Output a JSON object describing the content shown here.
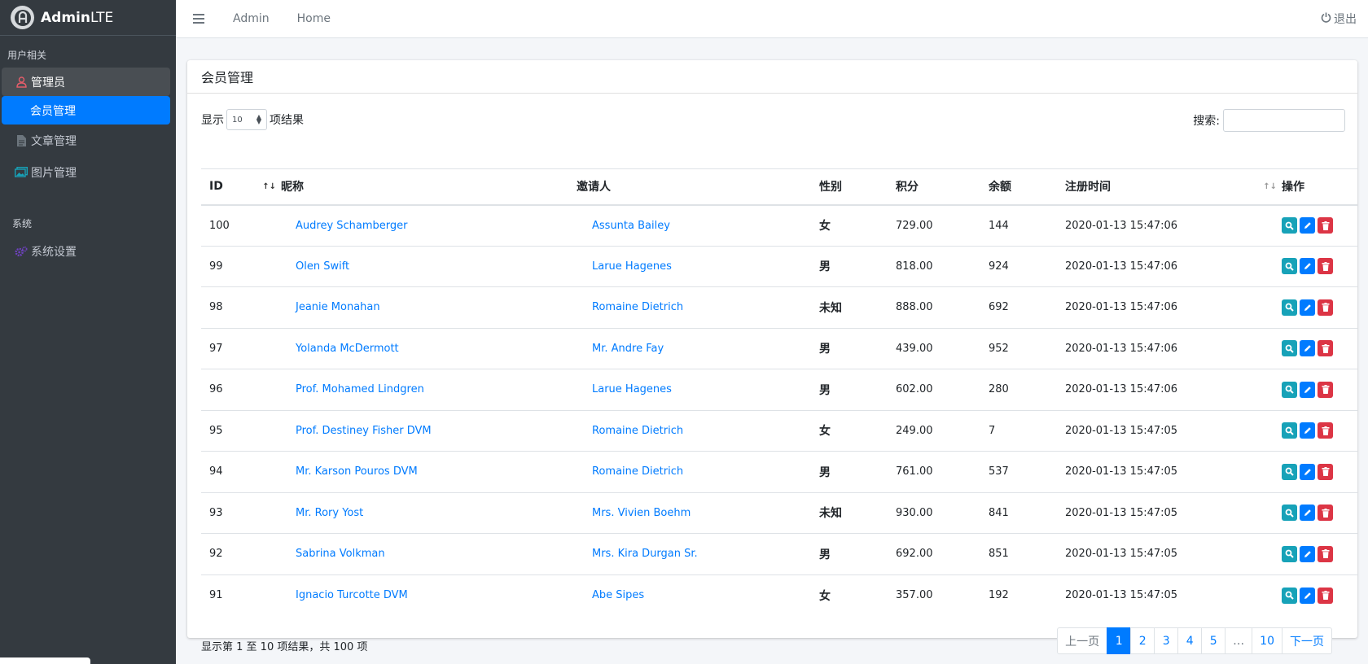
{
  "brand": {
    "name_bold": "Admin",
    "name_light": "LTE"
  },
  "sidebar": {
    "section1": "用户相关",
    "items": [
      {
        "label": "管理员",
        "icon": "user-icon"
      },
      {
        "label": "会员管理"
      },
      {
        "label": "文章管理",
        "icon": "file-icon"
      },
      {
        "label": "图片管理",
        "icon": "images-icon"
      }
    ],
    "section2": "系统",
    "system_item": {
      "label": "系统设置",
      "icon": "cogs-icon"
    }
  },
  "topnav": {
    "admin": "Admin",
    "home": "Home",
    "logout": "退出"
  },
  "card": {
    "title": "会员管理"
  },
  "length": {
    "prefix": "显示",
    "value": "10",
    "suffix": "项结果"
  },
  "search": {
    "label": "搜索:"
  },
  "table": {
    "headers": [
      "ID",
      "昵称",
      "邀请人",
      "性别",
      "积分",
      "余额",
      "注册时间",
      "操作"
    ],
    "rows": [
      [
        "100",
        "Audrey Schamberger",
        "Assunta Bailey",
        "女",
        "729.00",
        "144",
        "2020-01-13 15:47:06"
      ],
      [
        "99",
        "Olen Swift",
        "Larue Hagenes",
        "男",
        "818.00",
        "924",
        "2020-01-13 15:47:06"
      ],
      [
        "98",
        "Jeanie Monahan",
        "Romaine Dietrich",
        "未知",
        "888.00",
        "692",
        "2020-01-13 15:47:06"
      ],
      [
        "97",
        "Yolanda McDermott",
        "Mr. Andre Fay",
        "男",
        "439.00",
        "952",
        "2020-01-13 15:47:06"
      ],
      [
        "96",
        "Prof. Mohamed Lindgren",
        "Larue Hagenes",
        "男",
        "602.00",
        "280",
        "2020-01-13 15:47:06"
      ],
      [
        "95",
        "Prof. Destiney Fisher DVM",
        "Romaine Dietrich",
        "女",
        "249.00",
        "7",
        "2020-01-13 15:47:05"
      ],
      [
        "94",
        "Mr. Karson Pouros DVM",
        "Romaine Dietrich",
        "男",
        "761.00",
        "537",
        "2020-01-13 15:47:05"
      ],
      [
        "93",
        "Mr. Rory Yost",
        "Mrs. Vivien Boehm",
        "未知",
        "930.00",
        "841",
        "2020-01-13 15:47:05"
      ],
      [
        "92",
        "Sabrina Volkman",
        "Mrs. Kira Durgan Sr.",
        "男",
        "692.00",
        "851",
        "2020-01-13 15:47:05"
      ],
      [
        "91",
        "Ignacio Turcotte DVM",
        "Abe Sipes",
        "女",
        "357.00",
        "192",
        "2020-01-13 15:47:05"
      ]
    ]
  },
  "footer": {
    "info": "显示第 1 至 10 项结果，共 100 项"
  },
  "pagination": {
    "prev": "上一页",
    "pages": [
      "1",
      "2",
      "3",
      "4",
      "5",
      "…",
      "10"
    ],
    "next": "下一页"
  },
  "colors": {
    "sidebar_bg": "#343a40",
    "primary": "#007bff",
    "info": "#17a2b8",
    "danger": "#dc3545"
  }
}
